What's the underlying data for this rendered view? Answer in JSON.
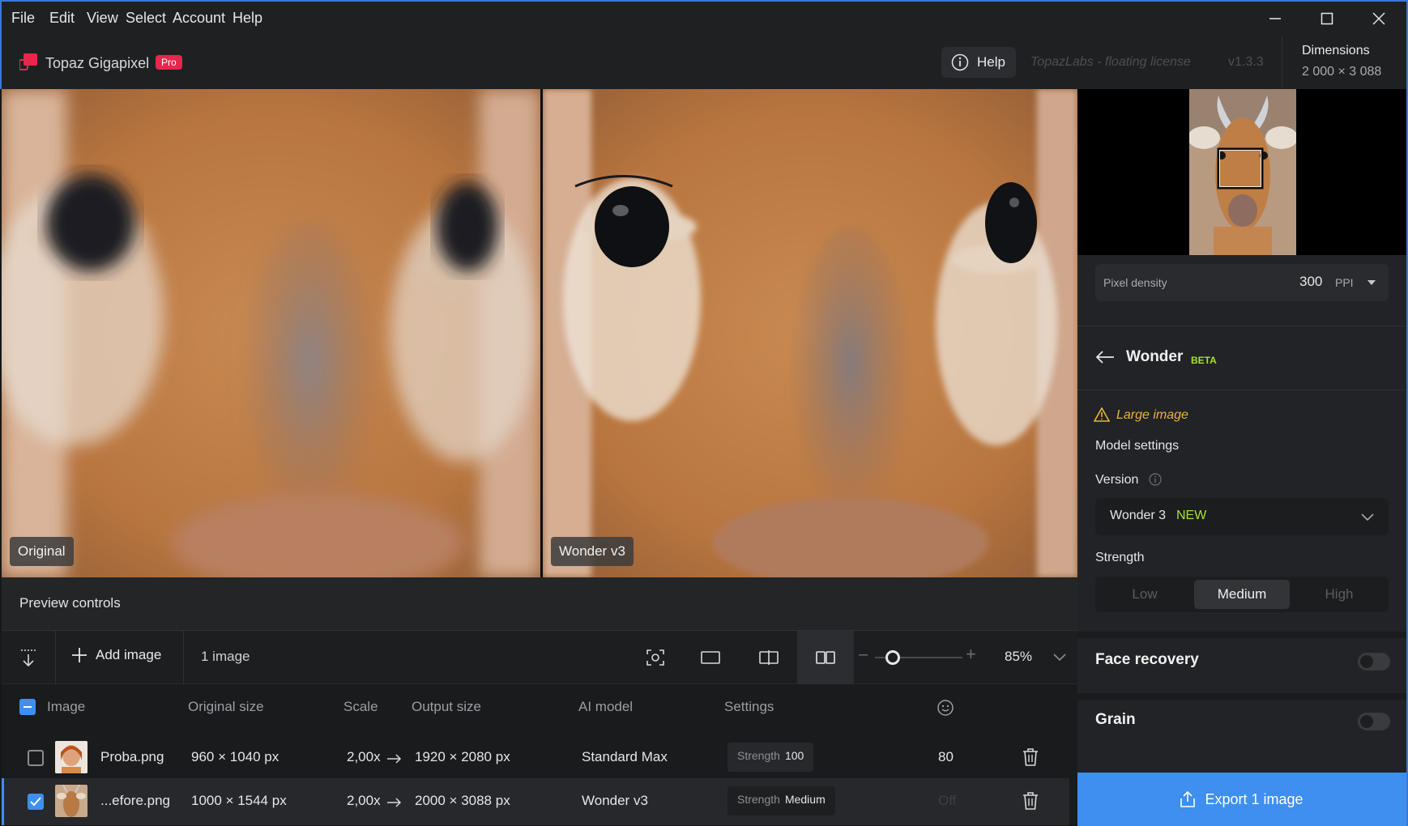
{
  "menu": [
    "File",
    "Edit",
    "View",
    "Select",
    "Account",
    "Help"
  ],
  "header": {
    "brand": "Topaz Gigapixel",
    "badge": "Pro",
    "help_label": "Help",
    "license": "TopazLabs - floating license",
    "version": "v1.3.3",
    "dimensions_title": "Dimensions",
    "dimensions_value": "2 000 × 3 088"
  },
  "preview": {
    "left_label": "Original",
    "right_label": "Wonder v3"
  },
  "preview_controls": {
    "title": "Preview controls"
  },
  "toolbar": {
    "add_image": "Add image",
    "image_count": "1 image",
    "zoom": "85%",
    "zoom_level": 0.2
  },
  "table": {
    "headers": [
      "Image",
      "Original size",
      "Scale",
      "Output size",
      "AI model",
      "Settings"
    ],
    "rows": [
      {
        "name": "Proba.png",
        "original_size": "960 × 1040 px",
        "scale": "2,00x",
        "output_size": "1920 × 2080 px",
        "model": "Standard Max",
        "setting_key": "Strength",
        "setting_value": "100",
        "face": "80",
        "checked": false
      },
      {
        "name": "...efore.png",
        "original_size": "1000 × 1544 px",
        "scale": "2,00x",
        "output_size": "2000 × 3088 px",
        "model": "Wonder v3",
        "setting_key": "Strength",
        "setting_value": "Medium",
        "face": "Off",
        "checked": true
      }
    ]
  },
  "right_panel": {
    "pixel_density_label": "Pixel density",
    "pixel_density_value": "300",
    "pixel_density_unit": "PPI",
    "model_name": "Wonder",
    "model_tag": "BETA",
    "warning": "Large image",
    "model_settings": "Model settings",
    "version_label": "Version",
    "version_value": "Wonder 3",
    "version_tag": "NEW",
    "strength_label": "Strength",
    "strength_options": [
      "Low",
      "Medium",
      "High"
    ],
    "strength_selected": "Medium",
    "face_recovery": "Face recovery",
    "grain": "Grain",
    "export_label": "Export 1 image"
  },
  "colors": {
    "accent": "#3e8ff0",
    "beta": "#a6e22e",
    "warning": "#e5b63a",
    "pro_badge": "#e8264e"
  }
}
